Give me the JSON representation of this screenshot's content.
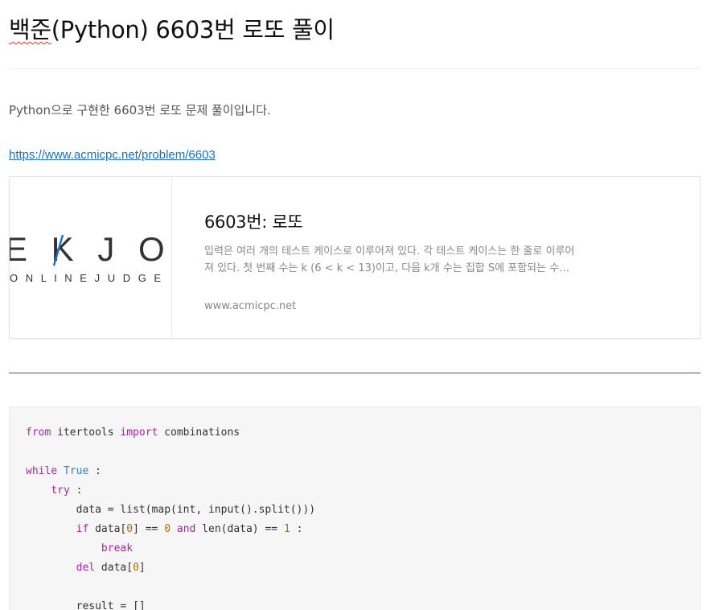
{
  "post": {
    "title_spell": "백준",
    "title_rest": "(Python) 6603번 로또 풀이",
    "intro": "Python으로 구현한 6603번 로또 문제 풀이입니다.",
    "link": "https://www.acmicpc.net/problem/6603"
  },
  "card": {
    "logo_top": "E K J O C",
    "logo_bottom": "O N L I N E   J U D G E",
    "title": "6603번: 로또",
    "description": "입력은 여러 개의 테스트 케이스로 이루어져 있다. 각 테스트 케이스는 한 줄로 이루어져 있다. 첫 번째 수는 k (6 < k < 13)이고, 다음 k개 수는 집합 S에 포함되는 수…",
    "domain": "www.acmicpc.net"
  },
  "code": {
    "l1": {
      "kw1": "from",
      "t1": " itertools ",
      "kw2": "import",
      "t2": " combinations"
    },
    "l3": {
      "kw": "while",
      "bi": "True",
      "t": " :"
    },
    "l4": {
      "indent": "    ",
      "kw": "try",
      "t": " :"
    },
    "l5": {
      "indent": "        ",
      "t": "data = list(map(int, input().split()))"
    },
    "l6": {
      "indent": "        ",
      "kw1": "if",
      "t1": " data[",
      "n1": "0",
      "t2": "] == ",
      "n2": "0",
      "kw2": "and",
      "t3": " len(data) == ",
      "n3": "1",
      "t4": " :"
    },
    "l7": {
      "indent": "            ",
      "kw": "break"
    },
    "l8": {
      "indent": "        ",
      "kw": "del",
      "t1": " data[",
      "n1": "0",
      "t2": "]"
    },
    "l10": {
      "indent": "        ",
      "t": "result = []"
    }
  },
  "colors": {
    "link": "#1a6fc9",
    "keyword": "#a626a4",
    "builtin": "#4078c8",
    "number": "#b76b01",
    "code_bg": "#f6f6f6",
    "logo_blue": "#1a6fc9"
  }
}
